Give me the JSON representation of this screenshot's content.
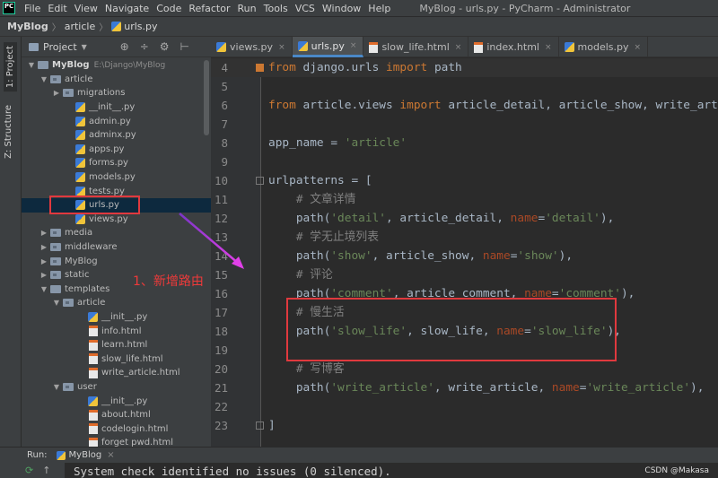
{
  "app": {
    "title": "MyBlog - urls.py - PyCharm - Administrator",
    "logo_text": "PC",
    "menu": [
      "File",
      "Edit",
      "View",
      "Navigate",
      "Code",
      "Refactor",
      "Run",
      "Tools",
      "VCS",
      "Window",
      "Help"
    ]
  },
  "breadcrumb": {
    "project": "MyBlog",
    "folder": "article",
    "file": "urls.py"
  },
  "left_strip": {
    "project_tab": "1: Project",
    "structure_tab": "Z: Structure"
  },
  "project_panel": {
    "header": "Project",
    "tools": [
      "⊕",
      "÷",
      "⚙",
      "⊢"
    ],
    "tree": [
      {
        "label": "MyBlog",
        "path": "E:\\Django\\MyBlog",
        "type": "folder",
        "arrow": "▼",
        "indent": 0,
        "bold": true
      },
      {
        "label": "article",
        "type": "folder",
        "arrow": "▼",
        "indent": 1
      },
      {
        "label": "migrations",
        "type": "folder",
        "arrow": "▶",
        "indent": 2
      },
      {
        "label": "__init__.py",
        "type": "py",
        "indent": 3
      },
      {
        "label": "admin.py",
        "type": "py",
        "indent": 3
      },
      {
        "label": "adminx.py",
        "type": "py",
        "indent": 3
      },
      {
        "label": "apps.py",
        "type": "py",
        "indent": 3
      },
      {
        "label": "forms.py",
        "type": "py",
        "indent": 3
      },
      {
        "label": "models.py",
        "type": "py",
        "indent": 3
      },
      {
        "label": "tests.py",
        "type": "py",
        "indent": 3
      },
      {
        "label": "urls.py",
        "type": "py",
        "indent": 3,
        "selected": true
      },
      {
        "label": "views.py",
        "type": "py",
        "indent": 3
      },
      {
        "label": "media",
        "type": "folder",
        "arrow": "▶",
        "indent": 1
      },
      {
        "label": "middleware",
        "type": "folder",
        "arrow": "▶",
        "indent": 1
      },
      {
        "label": "MyBlog",
        "type": "folder",
        "arrow": "▶",
        "indent": 1
      },
      {
        "label": "static",
        "type": "folder",
        "arrow": "▶",
        "indent": 1
      },
      {
        "label": "templates",
        "type": "folder",
        "arrow": "▼",
        "indent": 1
      },
      {
        "label": "article",
        "type": "folder",
        "arrow": "▼",
        "indent": 2
      },
      {
        "label": "__init__.py",
        "type": "py",
        "indent": 4
      },
      {
        "label": "info.html",
        "type": "html",
        "indent": 4
      },
      {
        "label": "learn.html",
        "type": "html",
        "indent": 4
      },
      {
        "label": "slow_life.html",
        "type": "html",
        "indent": 4
      },
      {
        "label": "write_article.html",
        "type": "html",
        "indent": 4
      },
      {
        "label": "user",
        "type": "folder",
        "arrow": "▼",
        "indent": 2
      },
      {
        "label": "__init__.py",
        "type": "py",
        "indent": 4
      },
      {
        "label": "about.html",
        "type": "html",
        "indent": 4
      },
      {
        "label": "codelogin.html",
        "type": "html",
        "indent": 4
      },
      {
        "label": "forget pwd.html",
        "type": "html",
        "indent": 4
      }
    ]
  },
  "editor": {
    "tabs": [
      {
        "label": "views.py",
        "type": "py"
      },
      {
        "label": "urls.py",
        "type": "py",
        "active": true
      },
      {
        "label": "slow_life.html",
        "type": "html"
      },
      {
        "label": "index.html",
        "type": "html"
      },
      {
        "label": "models.py",
        "type": "py"
      }
    ],
    "lines": [
      {
        "n": "4",
        "cur": true,
        "fold": true,
        "tokens": [
          [
            "kw",
            "from"
          ],
          [
            "t",
            " django.urls "
          ],
          [
            "kw",
            "import"
          ],
          [
            "t",
            " path"
          ]
        ]
      },
      {
        "n": "5",
        "tokens": []
      },
      {
        "n": "6",
        "tokens": [
          [
            "kw",
            "from"
          ],
          [
            "t",
            " article.views "
          ],
          [
            "kw",
            "import"
          ],
          [
            "t",
            " article_detail, article_show, write_article, a"
          ]
        ]
      },
      {
        "n": "7",
        "tokens": []
      },
      {
        "n": "8",
        "tokens": [
          [
            "t",
            "app_name = "
          ],
          [
            "str",
            "'article'"
          ]
        ]
      },
      {
        "n": "9",
        "tokens": []
      },
      {
        "n": "10",
        "fold": true,
        "tokens": [
          [
            "t",
            "urlpatterns = ["
          ]
        ]
      },
      {
        "n": "11",
        "tokens": [
          [
            "t",
            "    "
          ],
          [
            "cm",
            "# 文章详情"
          ]
        ]
      },
      {
        "n": "12",
        "tokens": [
          [
            "t",
            "    path("
          ],
          [
            "str",
            "'detail'"
          ],
          [
            "t",
            ", article_detail, "
          ],
          [
            "kwarg",
            "name"
          ],
          [
            "t",
            "="
          ],
          [
            "str",
            "'detail'"
          ],
          [
            "t",
            "),"
          ]
        ]
      },
      {
        "n": "13",
        "tokens": [
          [
            "t",
            "    "
          ],
          [
            "cm",
            "# 学无止境列表"
          ]
        ]
      },
      {
        "n": "14",
        "tokens": [
          [
            "t",
            "    path("
          ],
          [
            "str",
            "'show'"
          ],
          [
            "t",
            ", article_show, "
          ],
          [
            "kwarg",
            "name"
          ],
          [
            "t",
            "="
          ],
          [
            "str",
            "'show'"
          ],
          [
            "t",
            "),"
          ]
        ]
      },
      {
        "n": "15",
        "tokens": [
          [
            "t",
            "    "
          ],
          [
            "cm",
            "# 评论"
          ]
        ]
      },
      {
        "n": "16",
        "tokens": [
          [
            "t",
            "    path("
          ],
          [
            "str",
            "'comment'"
          ],
          [
            "t",
            ", article_comment, "
          ],
          [
            "kwarg",
            "name"
          ],
          [
            "t",
            "="
          ],
          [
            "str",
            "'comment'"
          ],
          [
            "t",
            "),"
          ]
        ]
      },
      {
        "n": "17",
        "tokens": [
          [
            "t",
            "    "
          ],
          [
            "cm",
            "# 慢生活"
          ]
        ]
      },
      {
        "n": "18",
        "tokens": [
          [
            "t",
            "    path("
          ],
          [
            "str",
            "'slow_life'"
          ],
          [
            "t",
            ", slow_life, "
          ],
          [
            "kwarg",
            "name"
          ],
          [
            "t",
            "="
          ],
          [
            "str",
            "'slow_life'"
          ],
          [
            "t",
            "),"
          ]
        ]
      },
      {
        "n": "19",
        "tokens": []
      },
      {
        "n": "20",
        "tokens": [
          [
            "t",
            "    "
          ],
          [
            "cm",
            "# 写博客"
          ]
        ]
      },
      {
        "n": "21",
        "tokens": [
          [
            "t",
            "    path("
          ],
          [
            "str",
            "'write_article'"
          ],
          [
            "t",
            ", write_article, "
          ],
          [
            "kwarg",
            "name"
          ],
          [
            "t",
            "="
          ],
          [
            "str",
            "'write_article'"
          ],
          [
            "t",
            "),"
          ]
        ]
      },
      {
        "n": "22",
        "tokens": []
      },
      {
        "n": "23",
        "fold": true,
        "tokens": [
          [
            "t",
            "]"
          ]
        ]
      }
    ]
  },
  "annotation": {
    "text": "1、新增路由"
  },
  "run": {
    "label": "Run:",
    "config": "MyBlog",
    "console_text": "System check identified no issues (0 silenced)."
  },
  "watermark": "CSDN @Makasa",
  "colors": {
    "accent": "#4a88c7",
    "annotation_red": "#e0393e",
    "arrow_magenta": "#e040e8"
  }
}
